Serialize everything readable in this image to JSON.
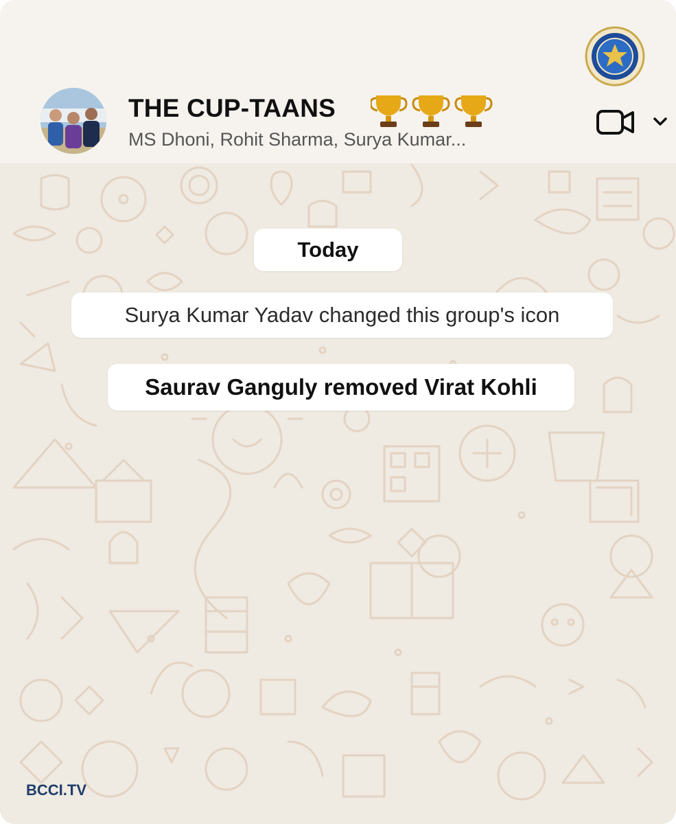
{
  "header": {
    "group_name": "THE CUP-TAANS",
    "trophy_emoji": "🏆🏆🏆",
    "members": "MS Dhoni, Rohit Sharma, Surya Kumar...",
    "video_call_icon": "video-camera-icon",
    "menu_icon": "chevron-down-icon"
  },
  "chat": {
    "date_label": "Today",
    "system_messages": [
      "Surya Kumar Yadav changed this group's icon",
      "Saurav Ganguly removed Virat Kohli"
    ]
  },
  "branding": {
    "emblem_icon": "bcci-emblem-icon",
    "watermark": "BCCI.TV"
  },
  "colors": {
    "wallpaper": "#efeae2",
    "pattern": "#e4d5c6",
    "header": "#f6f3ee",
    "bubble": "#ffffff",
    "accent": "#1f3d6b"
  }
}
